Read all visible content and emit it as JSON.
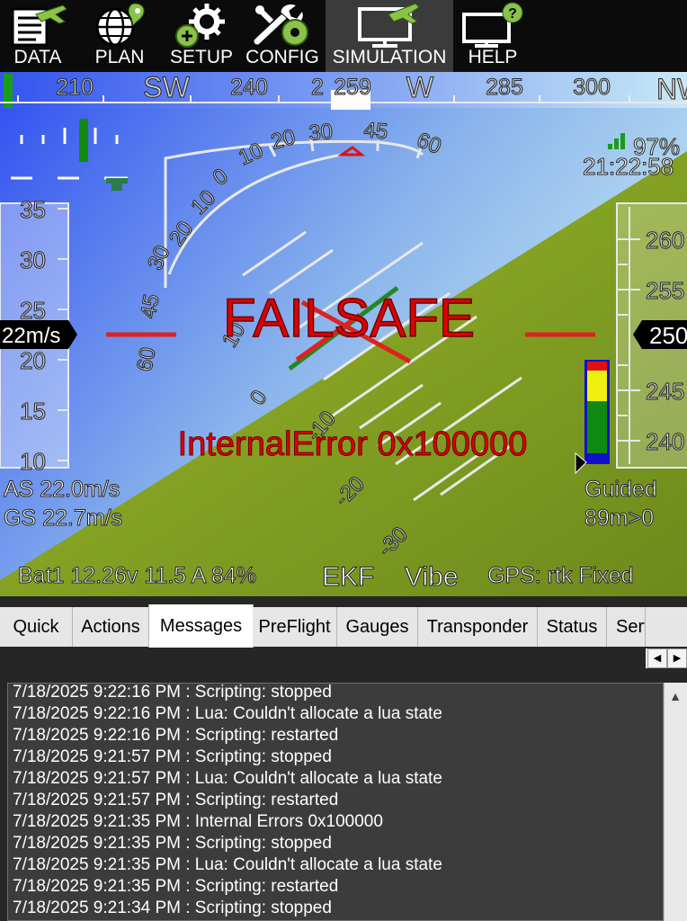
{
  "nav": {
    "items": [
      {
        "label": "DATA",
        "icon": "data-icon"
      },
      {
        "label": "PLAN",
        "icon": "plan-icon"
      },
      {
        "label": "SETUP",
        "icon": "setup-icon"
      },
      {
        "label": "CONFIG",
        "icon": "config-icon"
      },
      {
        "label": "SIMULATION",
        "icon": "simulation-icon",
        "active": true
      },
      {
        "label": "HELP",
        "icon": "help-icon"
      }
    ]
  },
  "hud": {
    "heading": {
      "ticks": [
        "210",
        "SW",
        "240",
        "2",
        "259",
        "W",
        "285",
        "300",
        "NW"
      ],
      "current": "259"
    },
    "battery_remaining": "97%",
    "clock": "21:22:58",
    "airspeed_scale": [
      "35",
      "30",
      "25",
      "20",
      "15",
      "10"
    ],
    "airspeed_current": "22m/s",
    "altitude_scale": [
      "260",
      "255",
      "250",
      "245",
      "240"
    ],
    "altitude_current": "250",
    "roll_scale": [
      "30",
      "20",
      "10",
      "0",
      "10",
      "20",
      "30",
      "45",
      "60"
    ],
    "pitch_scale_left": [
      "45",
      "30",
      "20",
      "10",
      "0"
    ],
    "pitch_scale_tilted": [
      "60",
      "45",
      "10",
      "0",
      "-10",
      "-20",
      "-30"
    ],
    "failsafe_text": "FAILSAFE",
    "error_text": "InternalError 0x100000",
    "as_text": "AS 22.0m/s",
    "gs_text": "GS 22.7m/s",
    "mode": "Guided",
    "wp_text": "89m>0",
    "battery_text": "Bat1 12.26v 11.5 A 84%",
    "ekf_text": "EKF",
    "vibe_text": "Vibe",
    "gps_text": "GPS: rtk Fixed",
    "colors": {
      "sky_top": "#3a55ee",
      "sky_bottom": "#b8e0ee",
      "ground": "#8aa624",
      "failsafe": "#dd0000"
    }
  },
  "tabs": {
    "items": [
      "Quick",
      "Actions",
      "Messages",
      "PreFlight",
      "Gauges",
      "Transponder",
      "Status",
      "Servo"
    ],
    "active": "Messages"
  },
  "messages": [
    "7/18/2025 9:22:16 PM : Scripting: stopped",
    "7/18/2025 9:22:16 PM : Lua: Couldn't allocate a lua state",
    "7/18/2025 9:22:16 PM : Scripting: restarted",
    "7/18/2025 9:21:57 PM : Scripting: stopped",
    "7/18/2025 9:21:57 PM : Lua: Couldn't allocate a lua state",
    "7/18/2025 9:21:57 PM : Scripting: restarted",
    "7/18/2025 9:21:35 PM : Internal Errors 0x100000",
    "7/18/2025 9:21:35 PM : Scripting: stopped",
    "7/18/2025 9:21:35 PM : Lua: Couldn't allocate a lua state",
    "7/18/2025 9:21:35 PM : Scripting: restarted",
    "7/18/2025 9:21:34 PM : Scripting: stopped"
  ]
}
